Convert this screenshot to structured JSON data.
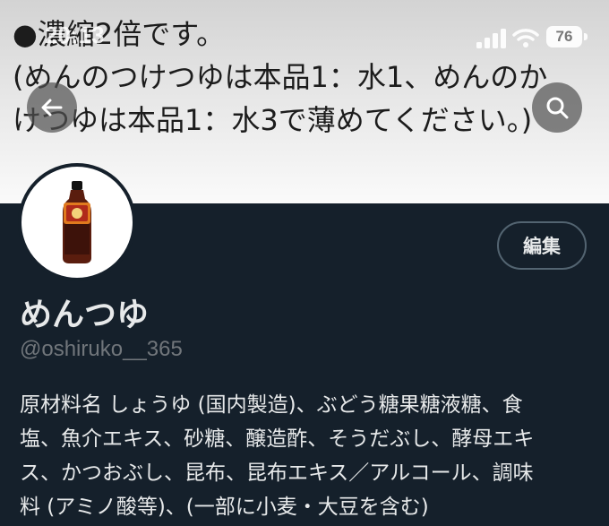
{
  "banner": {
    "lines": [
      "●濃縮2倍です。",
      "(めんのつけつゆは本品1：水1、めんのか",
      "けつゆは本品1：水3で薄めてください。)"
    ]
  },
  "status_bar": {
    "time": "20:13",
    "battery": "76"
  },
  "icons": {
    "back": "arrow-left-icon",
    "search": "search-icon",
    "signal": "signal-icon",
    "wifi": "wifi-icon",
    "battery": "battery-icon"
  },
  "profile": {
    "display_name": "めんつゆ",
    "handle": "@oshiruko__365",
    "edit_label": "編集",
    "bio_lines": [
      "原材料名 しょうゆ (国内製造)、ぶどう糖果糖液糖、食",
      "塩、魚介エキス、砂糖、醸造酢、そうだぶし、酵母エキ",
      "ス、かつおぶし、昆布、昆布エキス／アルコール、調味",
      "料 (アミノ酸等)、(一部に小麦・大豆を含む)"
    ]
  },
  "colors": {
    "background": "#15202b",
    "text_primary": "#e7e9ea",
    "text_secondary": "#71767b",
    "border": "#536471"
  }
}
